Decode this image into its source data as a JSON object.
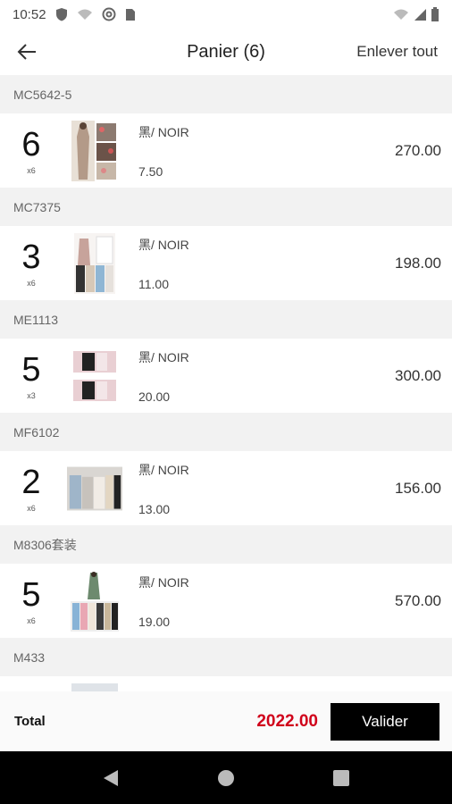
{
  "status_bar": {
    "time": "10:52"
  },
  "header": {
    "title": "Panier (6)",
    "clear_label": "Enlever tout"
  },
  "groups": [
    {
      "code": "MC5642-5",
      "qty": "6",
      "sub": "x6",
      "color": "黑/ NOIR",
      "unit_price": "7.50",
      "total": "270.00"
    },
    {
      "code": "MC7375",
      "qty": "3",
      "sub": "x6",
      "color": "黑/ NOIR",
      "unit_price": "11.00",
      "total": "198.00"
    },
    {
      "code": "ME1113",
      "qty": "5",
      "sub": "x3",
      "color": "黑/ NOIR",
      "unit_price": "20.00",
      "total": "300.00"
    },
    {
      "code": "MF6102",
      "qty": "2",
      "sub": "x6",
      "color": "黑/ NOIR",
      "unit_price": "13.00",
      "total": "156.00"
    },
    {
      "code": "M8306套装",
      "qty": "5",
      "sub": "x6",
      "color": "黑/ NOIR",
      "unit_price": "19.00",
      "total": "570.00"
    },
    {
      "code": "M433",
      "qty": "",
      "sub": "",
      "color": "",
      "unit_price": "",
      "total": ""
    }
  ],
  "footer": {
    "total_label": "Total",
    "total_value": "2022.00",
    "validate_label": "Valider"
  },
  "colors": {
    "accent_red": "#d0021b",
    "button_black": "#000000"
  },
  "icons": {
    "back": "arrow-left-icon",
    "nav_back": "triangle-back-icon",
    "nav_home": "circle-home-icon",
    "nav_recents": "square-recents-icon"
  }
}
